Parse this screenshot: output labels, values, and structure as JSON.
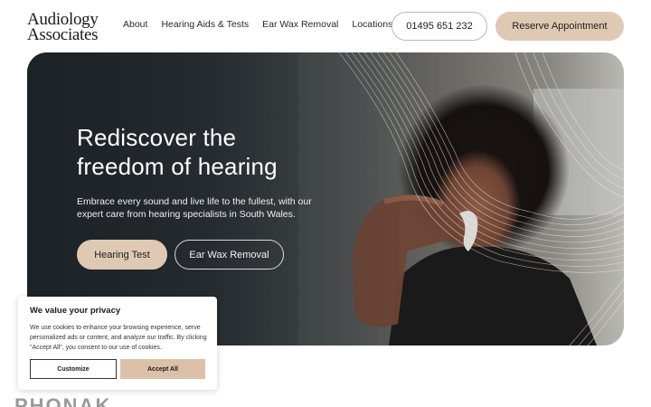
{
  "logo": {
    "line1": "Audiology",
    "line2": "Associates"
  },
  "nav": {
    "items": [
      {
        "label": "About"
      },
      {
        "label": "Hearing Aids & Tests"
      },
      {
        "label": "Ear Wax Removal"
      },
      {
        "label": "Locations"
      }
    ]
  },
  "header": {
    "phone_label": "01495 651 232",
    "reserve_label": "Reserve Appointment"
  },
  "hero": {
    "title_line1": "Rediscover the",
    "title_line2": "freedom of hearing",
    "subtitle": "Embrace every sound and live life to the fullest, with our expert care from hearing specialists in South Wales.",
    "primary_button": "Hearing Test",
    "secondary_button": "Ear Wax Removal"
  },
  "cookie": {
    "title": "We value your privacy",
    "text": "We use cookies to enhance your browsing experience, serve personalized ads or content, and analyze our traffic. By clicking \"Accept All\", you consent to our use of cookies.",
    "customize_label": "Customize",
    "accept_label": "Accept All"
  },
  "brand_peek": "PHONAK",
  "colors": {
    "accent": "#e0c9b3",
    "hero_dark": "#1f2529",
    "text": "#1d1d1f"
  }
}
